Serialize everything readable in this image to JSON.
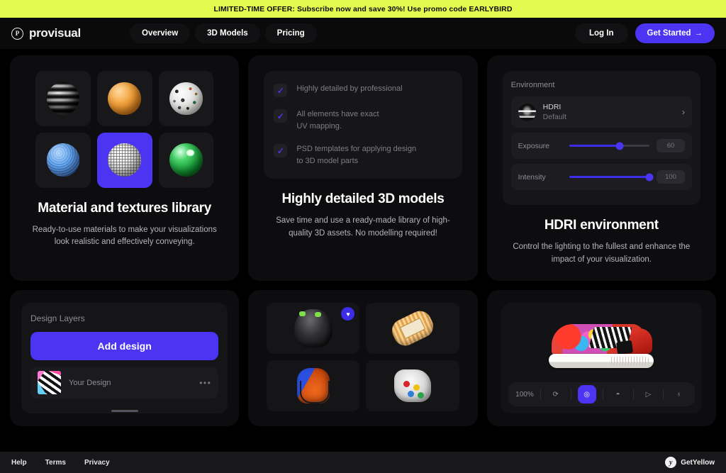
{
  "promo": {
    "text": "LIMITED-TIME OFFER: Subscribe now and save 30%! Use promo code EARLYBIRD",
    "background": "#E3FB4F"
  },
  "header": {
    "brand_mark": "P",
    "brand_name": "provisual",
    "nav": [
      {
        "label": "Overview"
      },
      {
        "label": "3D Models"
      },
      {
        "label": "Pricing"
      }
    ],
    "login_label": "Log In",
    "cta_label": "Get Started",
    "cta_arrow": "→",
    "accent": "#4B35F2"
  },
  "cards": {
    "materials": {
      "title": "Material and textures library",
      "description": "Ready-to-use materials to make your visualizations look realistic and effectively conveying.",
      "tiles": [
        {
          "name": "chrome-wave-sphere",
          "selected": false
        },
        {
          "name": "orange-bumpy-sphere",
          "selected": false
        },
        {
          "name": "terrazzo-sphere",
          "selected": false
        },
        {
          "name": "blue-dimpled-sphere",
          "selected": false
        },
        {
          "name": "white-grid-sphere",
          "selected": true
        },
        {
          "name": "green-glossy-sphere",
          "selected": false
        }
      ]
    },
    "models": {
      "title": "Highly detailed 3D models",
      "description": "Save time and use a ready-made library of high-quality 3D assets. No modelling required!",
      "checklist": [
        {
          "check": "✓",
          "text": "Highly detailed by professional"
        },
        {
          "check": "✓",
          "text": "All elements have exact\nUV mapping."
        },
        {
          "check": "✓",
          "text": "PSD templates for applying design\nto 3D model parts"
        }
      ]
    },
    "hdri": {
      "title": "HDRI environment",
      "description": "Control the lighting to the fullest and enhance the impact of your visualization.",
      "panel_title": "Environment",
      "hdri_row": {
        "label": "HDRI",
        "value": "Default",
        "chevron": "›"
      },
      "sliders": [
        {
          "label": "Exposure",
          "value": "60",
          "percent": 63
        },
        {
          "label": "Intensity",
          "value": "100",
          "percent": 100
        }
      ]
    },
    "design_layers": {
      "panel_title": "Design Layers",
      "add_button": "Add design",
      "layer_name": "Your Design",
      "layer_menu": "•••"
    },
    "model_gallery": {
      "items": [
        {
          "name": "black-backpack-model",
          "favorited": true,
          "fav_icon": "♥"
        },
        {
          "name": "gold-snack-pack-model",
          "favorited": false
        },
        {
          "name": "orange-basketball-bag-model",
          "favorited": false
        },
        {
          "name": "white-snack-bag-model",
          "favorited": false
        }
      ]
    },
    "viewer": {
      "model_name": "floral-sneaker-model",
      "toolbar": [
        {
          "name": "zoom-level",
          "label": "100%",
          "active": false
        },
        {
          "name": "rotate-icon",
          "label": "⟳",
          "active": false
        },
        {
          "name": "focus-target-icon",
          "label": "◎",
          "active": true
        },
        {
          "name": "lighting-dome-icon",
          "label": "◓",
          "active": false
        },
        {
          "name": "play-animation-icon",
          "label": "▷",
          "active": false
        },
        {
          "name": "gravity-icon",
          "label": "♁",
          "active": false
        }
      ]
    }
  },
  "footer": {
    "links": [
      {
        "label": "Help"
      },
      {
        "label": "Terms"
      },
      {
        "label": "Privacy"
      }
    ],
    "brand_mark": "y",
    "brand_name": "GetYellow"
  }
}
